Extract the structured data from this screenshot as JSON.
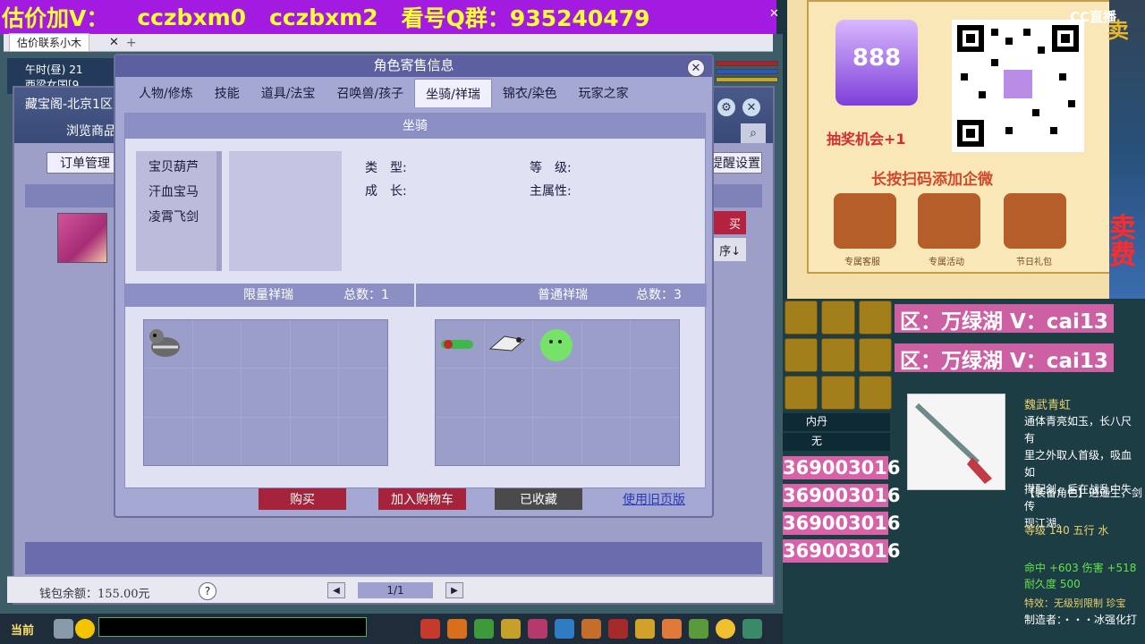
{
  "banner": {
    "estimate": "估价加V：",
    "wx1": "cczbxm0",
    "wx2": "cczbxm2",
    "qq_group": "看号Q群：935240479"
  },
  "game": {
    "window_tab": "估价联系小木",
    "time_label": "午时(昼)",
    "time_value": "21",
    "location": "西梁女国[9",
    "wallet": "钱包余额：155.00元",
    "help": "?",
    "pager": "1/1",
    "prev": "◀",
    "next": "▶",
    "chat_current": "当前"
  },
  "cangbaoge": {
    "title": "藏宝阁-北京1区",
    "nav": "浏览商品",
    "order_button": "订单管理",
    "settings_button": "提醒设置",
    "buy_button": "买",
    "sort_button": "序↓"
  },
  "dialog": {
    "title": "角色寄售信息",
    "close": "✕",
    "tabs": [
      {
        "label": "人物/修炼",
        "active": false
      },
      {
        "label": "技能",
        "active": false
      },
      {
        "label": "道具/法宝",
        "active": false
      },
      {
        "label": "召唤兽/孩子",
        "active": false
      },
      {
        "label": "坐骑/祥瑞",
        "active": true
      },
      {
        "label": "锦衣/染色",
        "active": false
      },
      {
        "label": "玩家之家",
        "active": false
      }
    ],
    "mount_header": "坐骑",
    "mounts": [
      "宝贝葫芦",
      "汗血宝马",
      "凌霄飞剑"
    ],
    "attrs": {
      "type_label": "类　型:",
      "level_label": "等　级:",
      "growth_label": "成　长:",
      "main_attr_label": "主属性:"
    },
    "limited": {
      "label": "限量祥瑞",
      "total": "总数：1"
    },
    "normal": {
      "label": "普通祥瑞",
      "total": "总数：3"
    },
    "buttons": {
      "buy": "购买",
      "add_cart": "加入购物车",
      "favorited": "已收藏",
      "old_version": "使用旧页版"
    },
    "colors": {
      "buy": "#a5233b",
      "add_cart": "#a5233b",
      "favorited": "#4a4a4a",
      "link": "#2a39b9"
    }
  },
  "promo": {
    "logo_text": "888",
    "lottery": "抽奖机会+1",
    "scan_tip": "长按扫码添加企微",
    "perks": [
      "专属客服",
      "专属活动",
      "节日礼包"
    ],
    "cc_logo": "CC直播",
    "sell_top": "卖",
    "sell_a": "卖",
    "sell_b": "费"
  },
  "stream": {
    "announcement_1": "区：万绿湖 V：cai13",
    "announcement_2": "区：万绿湖 V：cai13",
    "nei_dan": "内丹",
    "none": "无",
    "qq_numbers": [
      "369003016",
      "369003016",
      "369003016",
      "369003016"
    ]
  },
  "weapon": {
    "name": "魏武青虹",
    "desc": "通体青亮如玉，长八尺有\n里之外取人首级，吸血如\n撵配剑，后在战乱中失传\n现江湖。",
    "role": "【装备角色】逍遥生，剑",
    "level": "等级 140 五行 水",
    "stats": "命中 +603 伤害 +518\n耐久度 500",
    "effect": "特效：无级别限制 珍宝",
    "maker": "制造者：・・・冰强化打"
  }
}
